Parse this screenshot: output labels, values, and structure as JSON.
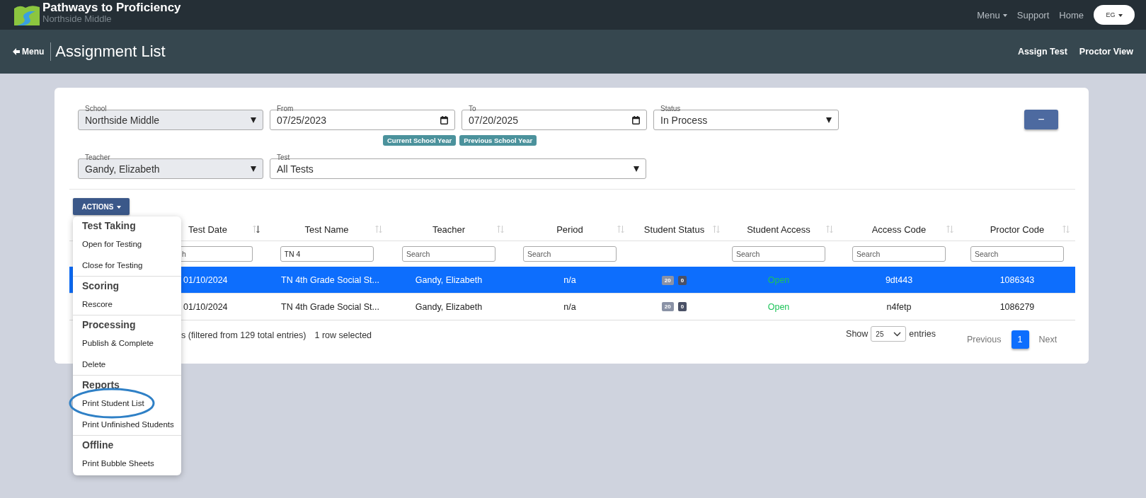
{
  "app": {
    "title": "Pathways to Proficiency",
    "subtitle": "Northside Middle"
  },
  "top_nav": [
    {
      "label": "Menu",
      "dropdown": true
    },
    {
      "label": "Support",
      "dropdown": false
    },
    {
      "label": "Home",
      "dropdown": false
    }
  ],
  "user_menu": {
    "label": "EG"
  },
  "page_header": {
    "back": "Menu",
    "title": "Assignment List",
    "actions": [
      "Assign Test",
      "Proctor View"
    ]
  },
  "filters": [
    [
      {
        "label": "School",
        "value": "Northside Middle",
        "kind": "select",
        "disabled": true
      },
      {
        "label": "From",
        "value": "07/25/2023",
        "kind": "date",
        "disabled": false
      },
      {
        "label": "To",
        "value": "07/20/2025",
        "kind": "date",
        "disabled": false
      },
      {
        "label": "Status",
        "value": "In Process",
        "kind": "select",
        "disabled": false
      }
    ],
    [
      {
        "label": "Teacher",
        "value": "Gandy, Elizabeth",
        "kind": "select",
        "disabled": true
      },
      {
        "label": "Test",
        "value": "All Tests",
        "kind": "select",
        "disabled": false
      }
    ]
  ],
  "quick_ranges": [
    "Current School Year",
    "Previous School Year"
  ],
  "collapse_button": "−",
  "actions_button": "ACTIONS",
  "actions_menu": [
    {
      "heading": "Test Taking",
      "items": [
        {
          "label": "Open for Testing",
          "circled": false
        },
        {
          "label": "Close for Testing",
          "circled": false
        }
      ]
    },
    {
      "heading": "Scoring",
      "items": [
        {
          "label": "Rescore",
          "circled": false
        }
      ]
    },
    {
      "heading": "Processing",
      "items": [
        {
          "label": "Publish & Complete",
          "circled": false
        },
        {
          "label": "Delete",
          "circled": false
        }
      ]
    },
    {
      "heading": "Reports",
      "items": [
        {
          "label": "Print Student List",
          "circled": true
        },
        {
          "label": "Print Unfinished Students",
          "circled": false
        }
      ]
    },
    {
      "heading": "Offline",
      "items": [
        {
          "label": "Print Bubble Sheets",
          "circled": false
        }
      ]
    }
  ],
  "table": {
    "columns": [
      {
        "label": "Test Date",
        "sorted": true
      },
      {
        "label": "Test Name",
        "sorted": false
      },
      {
        "label": "Teacher",
        "sorted": false
      },
      {
        "label": "Period",
        "sorted": false
      },
      {
        "label": "Student Status",
        "sorted": false
      },
      {
        "label": "Student Access",
        "sorted": false
      },
      {
        "label": "Access Code",
        "sorted": false
      },
      {
        "label": "Proctor Code",
        "sorted": false
      }
    ],
    "column_filters": [
      {
        "kind": "search",
        "placeholder": "h"
      },
      {
        "kind": "search",
        "value": "TN 4"
      },
      {
        "kind": "search",
        "placeholder": "Search"
      },
      {
        "kind": "search",
        "placeholder": "Search"
      },
      {
        "kind": "none"
      },
      {
        "kind": "search",
        "placeholder": "Search"
      },
      {
        "kind": "search",
        "placeholder": "Search"
      },
      {
        "kind": "search",
        "placeholder": "Search"
      }
    ],
    "rows": [
      {
        "selected": true,
        "test_date": "01/10/2024",
        "test_name": "TN 4th Grade Social St...",
        "teacher": "Gandy, Elizabeth",
        "period": "n/a",
        "student_status": [
          "20",
          "0"
        ],
        "student_access": "Open",
        "access_code": "9dt443",
        "proctor_code": "1086343"
      },
      {
        "selected": false,
        "test_date": "01/10/2024",
        "test_name": "TN 4th Grade Social St...",
        "teacher": "Gandy, Elizabeth",
        "period": "n/a",
        "student_status": [
          "20",
          "0"
        ],
        "student_access": "Open",
        "access_code": "n4fetp",
        "proctor_code": "1086279"
      }
    ]
  },
  "footer": {
    "info": "s (filtered from 129 total entries)",
    "selection": "1 row selected",
    "show_label": "Show",
    "page_length": "25",
    "entries_label": "entries",
    "pagination": [
      {
        "label": "Previous",
        "kind": "link",
        "selected": false
      },
      {
        "label": "1",
        "kind": "page",
        "selected": true
      },
      {
        "label": "Next",
        "kind": "link",
        "selected": false
      }
    ]
  }
}
